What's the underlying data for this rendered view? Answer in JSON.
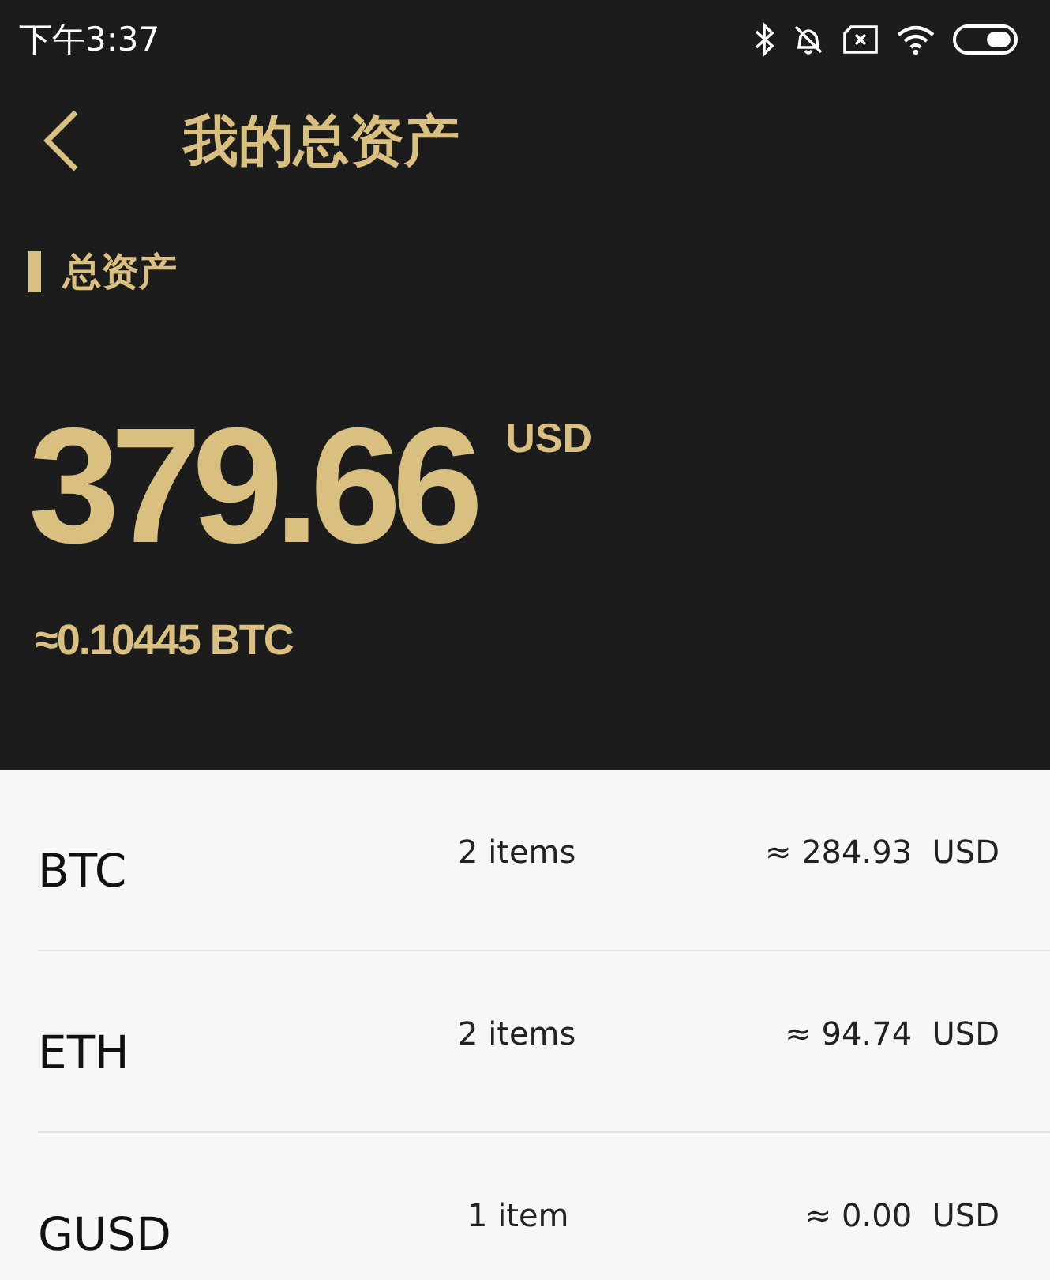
{
  "status_bar": {
    "time": "下午3:37"
  },
  "header": {
    "title": "我的总资产"
  },
  "summary": {
    "label": "总资产",
    "amount": "379.66",
    "currency": "USD",
    "btc_equivalent": "≈0.10445 BTC"
  },
  "assets": [
    {
      "symbol": "BTC",
      "count": "2 items",
      "value": "≈ 284.93",
      "currency": "USD"
    },
    {
      "symbol": "ETH",
      "count": "2 items",
      "value": "≈ 94.74",
      "currency": "USD"
    },
    {
      "symbol": "GUSD",
      "count": "1 item",
      "value": "≈ 0.00",
      "currency": "USD"
    }
  ]
}
